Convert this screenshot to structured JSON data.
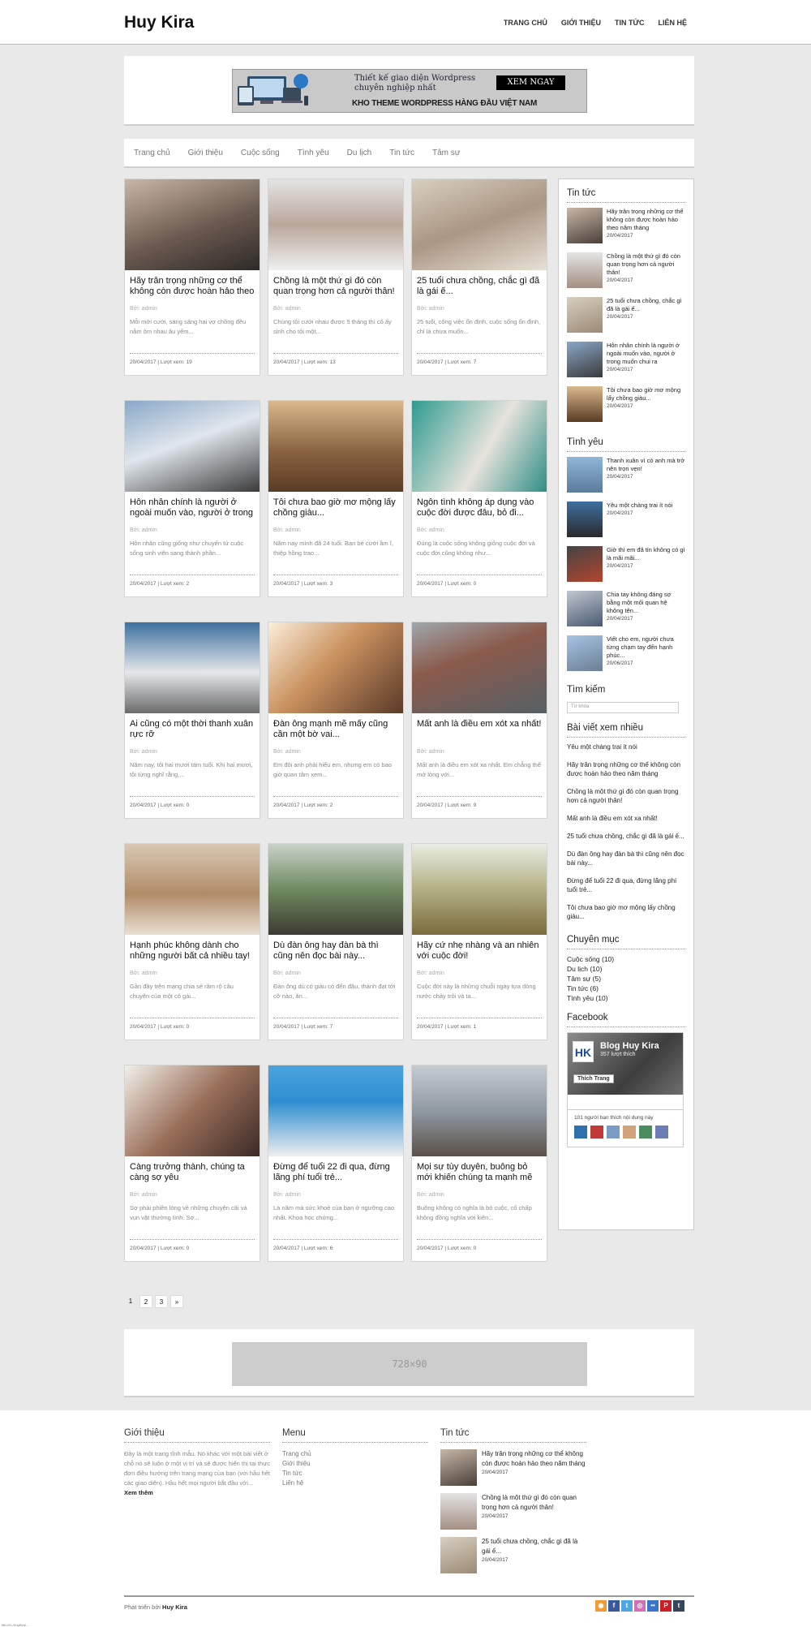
{
  "page_header_small": "Huy Kira",
  "page_footer_small": "file:///C:/HuyKira/...",
  "site": {
    "logo": "Huy Kira"
  },
  "topnav": [
    "TRANG CHỦ",
    "GIỚI THIỆU",
    "TIN TỨC",
    "LIÊN HỆ"
  ],
  "banner": {
    "line1": "Thiết kế giao diện Wordpress chuyên nghiệp nhất",
    "line2": "KHO THEME WORDPRESS HÀNG ĐẦU VIỆT NAM",
    "button": "XEM NGAY"
  },
  "catnav": [
    "Trang chủ",
    "Giới thiệu",
    "Cuộc sống",
    "Tình yêu",
    "Du lịch",
    "Tin tức",
    "Tâm sự"
  ],
  "posts": [
    {
      "title": "Hãy trân trọng những cơ thể không còn được hoàn hảo theo",
      "author": "Bởi: admin",
      "excerpt": "Mỗi mới cưới, sáng sáng hai vợ chồng đều nằm ôm nhau âu yếm...",
      "meta": "20/04/2017 | Lượt xem: 19"
    },
    {
      "title": "Chồng là một thứ gì đó còn quan trọng hơn cả người thân!",
      "author": "Bởi: admin",
      "excerpt": "Chúng tôi cưới nhau được 5 tháng thì cô ấy sinh cho tôi một...",
      "meta": "20/04/2017 | Lượt xem: 13"
    },
    {
      "title": "25 tuổi chưa chồng, chắc gì đã là gái ế...",
      "author": "Bởi: admin",
      "excerpt": "25 tuổi, công việc ổn định, cuộc sống ổn định, chỉ là chưa muốn...",
      "meta": "20/04/2017 | Lượt xem: 7"
    },
    {
      "title": "Hôn nhân chính là người ở ngoài muốn vào, người ở trong",
      "author": "Bởi: admin",
      "excerpt": "Hôn nhân cũng giống như chuyến tứ cuộc sống sinh viên sang thành phần...",
      "meta": "20/04/2017 | Lượt xem: 2"
    },
    {
      "title": "Tôi chưa bao giờ mơ mộng lấy chồng giàu...",
      "author": "Bởi: admin",
      "excerpt": "Năm nay mình đã 24 tuổi. Bạn bè cưới ầm ĩ, thiệp hồng trao...",
      "meta": "20/04/2017 | Lượt xem: 3"
    },
    {
      "title": "Ngôn tình không áp dụng vào cuộc đời được đâu, bỏ đi...",
      "author": "Bởi: admin",
      "excerpt": "Đúng là cuộc sống không giống cuộc đời và cuộc đời cũng không như...",
      "meta": "20/04/2017 | Lượt xem: 0"
    },
    {
      "title": "Ai cũng có một thời thanh xuân rực rỡ",
      "author": "Bởi: admin",
      "excerpt": "Năm nay, tôi hai mươi tám tuổi. Khi hai mươi, tôi từng nghĩ rằng,...",
      "meta": "20/04/2017 | Lượt xem: 0"
    },
    {
      "title": "Đàn ông mạnh mẽ mấy cũng cần một bờ vai...",
      "author": "Bởi: admin",
      "excerpt": "Em đôi anh phải hiểu em, nhưng em có bao giờ quan tâm xem...",
      "meta": "20/04/2017 | Lượt xem: 2"
    },
    {
      "title": "Mất anh là điều em xót xa nhất!",
      "author": "Bởi: admin",
      "excerpt": "Mất anh là điều em xót xa nhất. Em chẳng thể mở lòng với...",
      "meta": "20/04/2017 | Lượt xem: 9"
    },
    {
      "title": "Hạnh phúc không dành cho những người bất cả nhiều tay!",
      "author": "Bởi: admin",
      "excerpt": "Gần đây trên mạng chia sẻ rầm rộ câu chuyện của một cô gái...",
      "meta": "20/04/2017 | Lượt xem: 0"
    },
    {
      "title": "Dù đàn ông hay đàn bà thì cũng nên đọc bài này...",
      "author": "Bởi: admin",
      "excerpt": "Đàn ông dù có giàu có đến đâu, thành đạt tới cỡ nào, ăn...",
      "meta": "20/04/2017 | Lượt xem: 7"
    },
    {
      "title": "Hãy cứ nhẹ nhàng và an nhiên với cuộc đời!",
      "author": "Bởi: admin",
      "excerpt": "Cuộc đời này là những chuỗi ngày tựa dòng nước chảy trôi và ta...",
      "meta": "20/04/2017 | Lượt xem: 1"
    },
    {
      "title": "Càng trưởng thành, chúng ta càng sợ yêu",
      "author": "Bởi: admin",
      "excerpt": "Sợ phải phiền lòng về những chuyện cãi và vụn vặt thường tình. Sợ...",
      "meta": "20/04/2017 | Lượt xem: 0"
    },
    {
      "title": "Đừng để tuổi 22 đi qua, đừng lãng phí tuổi trẻ...",
      "author": "Bởi: admin",
      "excerpt": "Là năm mà sức khoẻ của bạn ở ngưỡng cao nhất. Khoa học chứng...",
      "meta": "20/04/2017 | Lượt xem: 6"
    },
    {
      "title": "Mọi sự tùy duyên, buông bỏ mới khiến chúng ta mạnh mẽ",
      "author": "Bởi: admin",
      "excerpt": "Buông không có nghĩa là bỏ cuộc, cố chấp không đồng nghĩa với kiên...",
      "meta": "20/04/2017 | Lượt xem: 0"
    }
  ],
  "pager": [
    "1",
    "2",
    "3",
    "»"
  ],
  "ad2": "728×90",
  "sidebar": {
    "news_heading": "Tin tức",
    "news": [
      {
        "title": "Hãy trân trọng những cơ thể không còn được hoàn hảo theo năm tháng",
        "date": "20/04/2017"
      },
      {
        "title": "Chồng là một thứ gì đó còn quan trọng hơn cả người thân!",
        "date": "20/04/2017"
      },
      {
        "title": "25 tuổi chưa chồng, chắc gì đã là gái ế...",
        "date": "20/04/2017"
      },
      {
        "title": "Hôn nhân chính là người ở ngoài muốn vào, người ở trong muốn chui ra",
        "date": "20/04/2017"
      },
      {
        "title": "Tôi chưa bao giờ mơ mộng lấy chồng giàu...",
        "date": "20/04/2017"
      }
    ],
    "love_heading": "Tình yêu",
    "love": [
      {
        "title": "Thanh xuân vì có anh mà trở nên trọn vẹn!",
        "date": "20/04/2017"
      },
      {
        "title": "Yêu một chàng trai ít nói",
        "date": "20/04/2017"
      },
      {
        "title": "Giờ thì em đã tin không có gì là mãi mãi...",
        "date": "20/04/2017"
      },
      {
        "title": "Chia tay không đáng sợ bằng một mối quan hệ không tên...",
        "date": "20/04/2017"
      },
      {
        "title": "Viết cho em, người chưa từng chạm tay đến hạnh phúc...",
        "date": "20/06/2017"
      }
    ],
    "search_heading": "Tìm kiếm",
    "search_placeholder": "Từ khóa",
    "popular_heading": "Bài viết xem nhiều",
    "popular": [
      "Yêu một chàng trai ít nói",
      "Hãy trân trọng những cơ thể không còn được hoàn hảo theo năm tháng",
      "Chồng là một thứ gì đó còn quan trọng hơn cả người thân!",
      "Mất anh là điều em xót xa nhất!",
      "25 tuổi chưa chồng, chắc gì đã là gái ế...",
      "Dù đàn ông hay đàn bà thì cũng nên đọc bài này...",
      "Đừng để tuổi 22 đi qua, đừng lãng phí tuổi trẻ...",
      "Tôi chưa bao giờ mơ mộng lấy chồng giàu..."
    ],
    "cat_heading": "Chuyên mục",
    "categories": [
      "Cuộc sống (10)",
      "Du lịch (10)",
      "Tâm sự (5)",
      "Tin tức (6)",
      "Tình yêu (10)"
    ],
    "fb_heading": "Facebook",
    "fb_logo": "HK",
    "fb_name": "Blog Huy Kira",
    "fb_likes": "357 lượt thích",
    "fb_like_btn": "Thích Trang",
    "fb_friends": "101 người bạn thích nội dung này"
  },
  "footer": {
    "about_heading": "Giới thiệu",
    "about_text": "Đây là một trang tĩnh mẫu. Nó khác với một bài viết ở chỗ nó sẽ luôn ở một vị trí và sẽ được hiển thị tại thực đơn điều hướng trên trang mạng của bạn (với hầu hết các giao diện). Hầu hết mọi người bắt đầu với...",
    "about_more": "Xem thêm",
    "menu_heading": "Menu",
    "menu": [
      "Trang chủ",
      "Giới thiệu",
      "Tin tức",
      "Liên hệ"
    ],
    "news_heading": "Tin tức",
    "news": [
      {
        "title": "Hãy trân trọng những cơ thể không còn được hoàn hảo theo năm tháng",
        "date": "20/04/2017"
      },
      {
        "title": "Chồng là một thứ gì đó còn quan trọng hơn cả người thân!",
        "date": "20/04/2017"
      },
      {
        "title": "25 tuổi chưa chồng, chắc gì đã là gái ế...",
        "date": "20/04/2017"
      }
    ],
    "copyright_prefix": "Phát triển bởi",
    "copyright_name": "Huy Kira",
    "socials": [
      {
        "icon": "rss-icon",
        "glyph": "◉",
        "color": "#f29a38"
      },
      {
        "icon": "facebook-icon",
        "glyph": "f",
        "color": "#3b5998"
      },
      {
        "icon": "twitter-icon",
        "glyph": "t",
        "color": "#4fa6e0"
      },
      {
        "icon": "instagram-icon",
        "glyph": "◎",
        "color": "#d36fb4"
      },
      {
        "icon": "flickr-icon",
        "glyph": "••",
        "color": "#3b74cb"
      },
      {
        "icon": "pinterest-icon",
        "glyph": "P",
        "color": "#cb2027"
      },
      {
        "icon": "tumblr-icon",
        "glyph": "t",
        "color": "#35465c"
      }
    ]
  }
}
